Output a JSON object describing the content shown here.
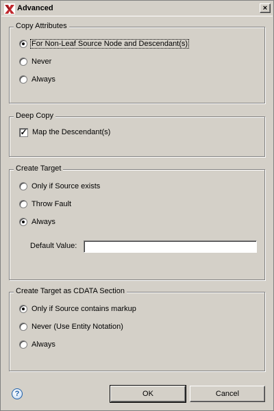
{
  "window": {
    "title": "Advanced",
    "close_label": "×"
  },
  "copy_attributes": {
    "title": "Copy Attributes",
    "options": [
      {
        "label": "For Non-Leaf Source Node and Descendant(s)",
        "checked": true
      },
      {
        "label": "Never",
        "checked": false
      },
      {
        "label": "Always",
        "checked": false
      }
    ]
  },
  "deep_copy": {
    "title": "Deep Copy",
    "checkbox_label": "Map the Descendant(s)",
    "checked": true
  },
  "create_target": {
    "title": "Create Target",
    "options": [
      {
        "label": "Only if Source exists",
        "checked": false
      },
      {
        "label": "Throw Fault",
        "checked": false
      },
      {
        "label": "Always",
        "checked": true
      }
    ],
    "default_value_label": "Default Value:",
    "default_value": ""
  },
  "create_target_cdata": {
    "title": "Create Target as CDATA Section",
    "options": [
      {
        "label": "Only if Source contains markup",
        "checked": true
      },
      {
        "label": "Never (Use Entity Notation)",
        "checked": false
      },
      {
        "label": "Always",
        "checked": false
      }
    ]
  },
  "footer": {
    "help_label": "?",
    "ok_label": "OK",
    "cancel_label": "Cancel"
  }
}
